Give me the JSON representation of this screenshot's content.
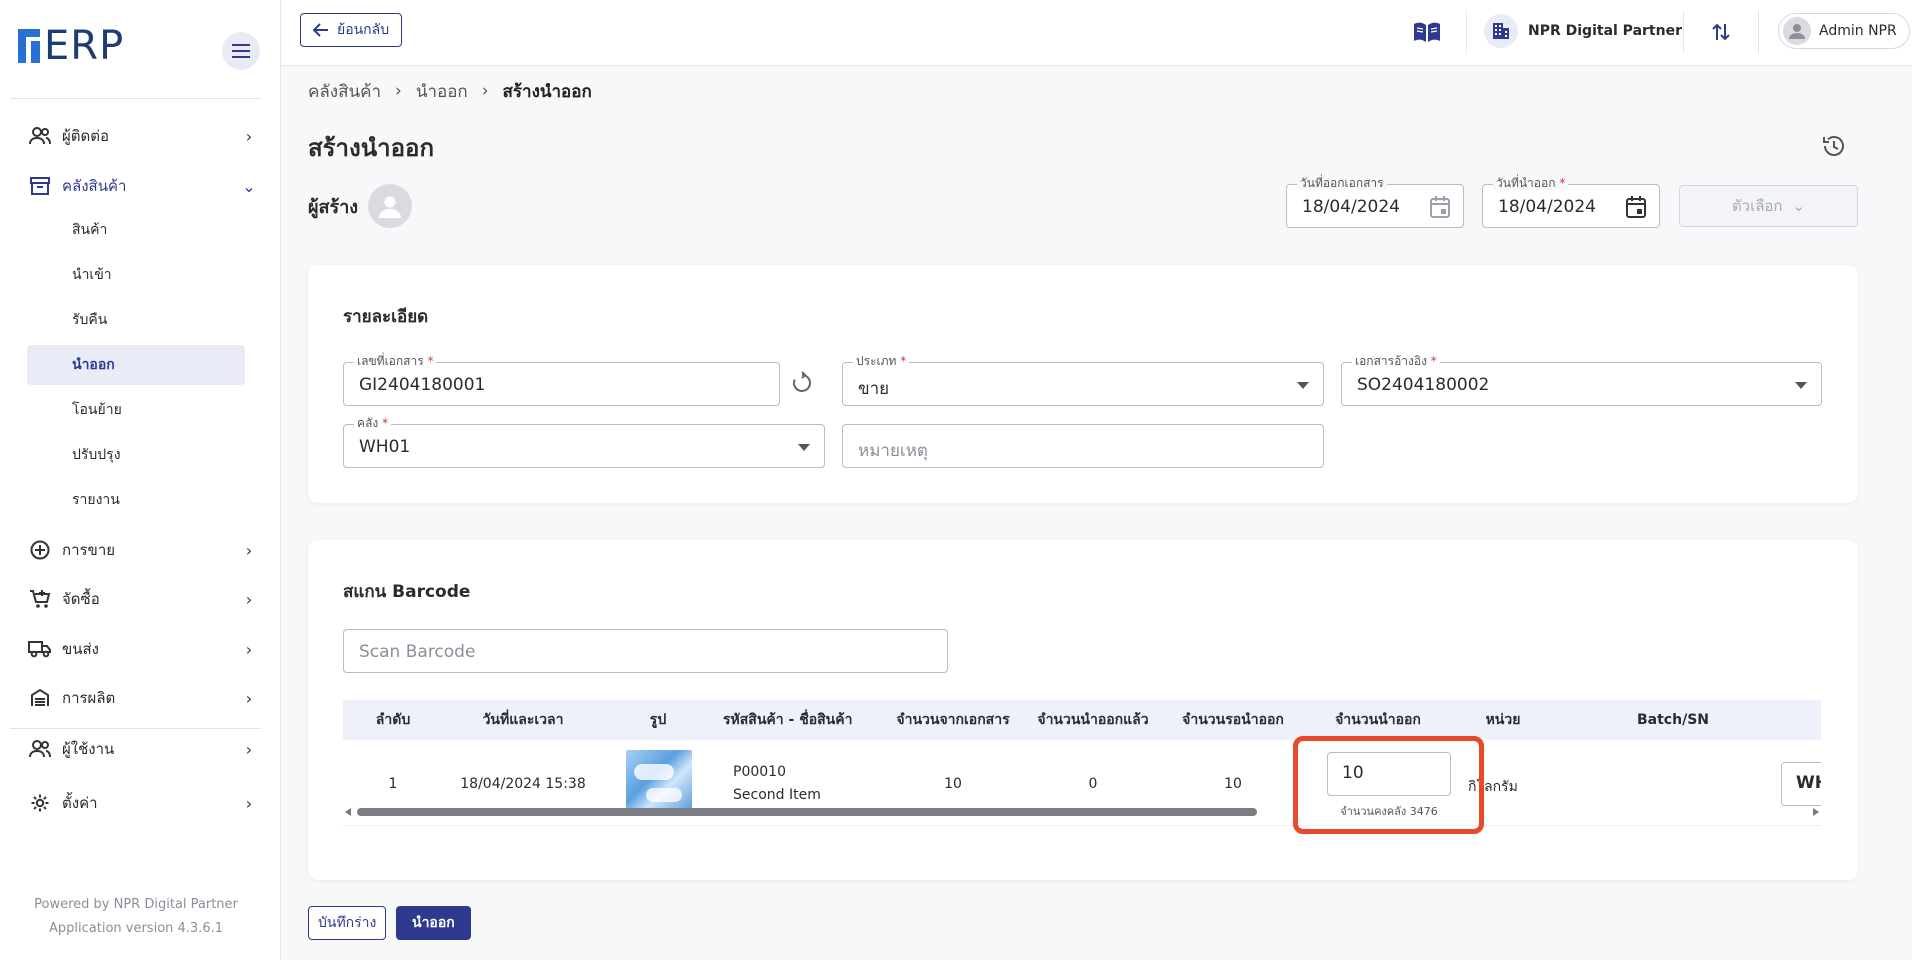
{
  "app": {
    "logo_text": "ERP",
    "brand_color": "#2a6fd6",
    "accent_color": "#2f3a8f"
  },
  "sidebar": {
    "items": [
      {
        "label": "ผู้ติดต่อ",
        "icon": "contacts-icon"
      },
      {
        "label": "คลังสินค้า",
        "icon": "warehouse-icon",
        "expanded": true
      },
      {
        "label": "การขาย",
        "icon": "plus-circle-icon"
      },
      {
        "label": "จัดซื้อ",
        "icon": "cart-icon"
      },
      {
        "label": "ขนส่ง",
        "icon": "truck-icon"
      },
      {
        "label": "การผลิต",
        "icon": "factory-icon"
      },
      {
        "label": "ผู้ใช้งาน",
        "icon": "users-icon"
      },
      {
        "label": "ตั้งค่า",
        "icon": "gear-icon"
      }
    ],
    "sub_items": [
      {
        "label": "สินค้า"
      },
      {
        "label": "นำเข้า"
      },
      {
        "label": "รับคืน"
      },
      {
        "label": "นำออก",
        "active": true
      },
      {
        "label": "โอนย้าย"
      },
      {
        "label": "ปรับปรุง"
      },
      {
        "label": "รายงาน"
      }
    ],
    "powered_by": "Powered by NPR Digital Partner",
    "version": "Application version 4.3.6.1"
  },
  "topbar": {
    "back_label": "ย้อนกลับ",
    "company": "NPR Digital Partner",
    "user": "Admin NPR"
  },
  "breadcrumb": [
    "คลังสินค้า",
    "นำออก",
    "สร้างนำออก"
  ],
  "page": {
    "title": "สร้างนำออก",
    "creator_label": "ผู้สร้าง",
    "issue_date_label": "วันที่ออกเอกสาร",
    "issue_date": "18/04/2024",
    "out_date_label": "วันที่นำออก",
    "out_date": "18/04/2024",
    "options_label": "ตัวเลือก"
  },
  "details": {
    "title": "รายละเอียด",
    "doc_no_label": "เลขที่เอกสาร",
    "doc_no": "GI2404180001",
    "type_label": "ประเภท",
    "type": "ขาย",
    "ref_label": "เอกสารอ้างอิง",
    "ref": "SO2404180002",
    "warehouse_label": "คลัง",
    "warehouse": "WH01",
    "remark_placeholder": "หมายเหตุ"
  },
  "scan": {
    "title": "สแกน Barcode",
    "placeholder": "Scan Barcode"
  },
  "table": {
    "headers": [
      "ลำดับ",
      "วันที่และเวลา",
      "รูป",
      "รหัสสินค้า - ชื่อสินค้า",
      "จำนวนจากเอกสาร",
      "จำนวนนำออกแล้ว",
      "จำนวนรอนำออก",
      "จำนวนนำออก",
      "หน่วย",
      "Batch/SN"
    ],
    "rows": [
      {
        "no": "1",
        "datetime": "18/04/2024 15:38",
        "code": "P00010",
        "name": "Second Item",
        "doc_qty": "10",
        "issued_qty": "0",
        "pending_qty": "10",
        "issue_qty": "10",
        "stock_note": "จำนวนคงคลัง 3476",
        "unit": "กิโลกรัม",
        "batch": "WH"
      }
    ]
  },
  "actions": {
    "draft_label": "บันทึกร่าง",
    "issue_label": "นำออก"
  },
  "highlight_color": "#e8492b"
}
